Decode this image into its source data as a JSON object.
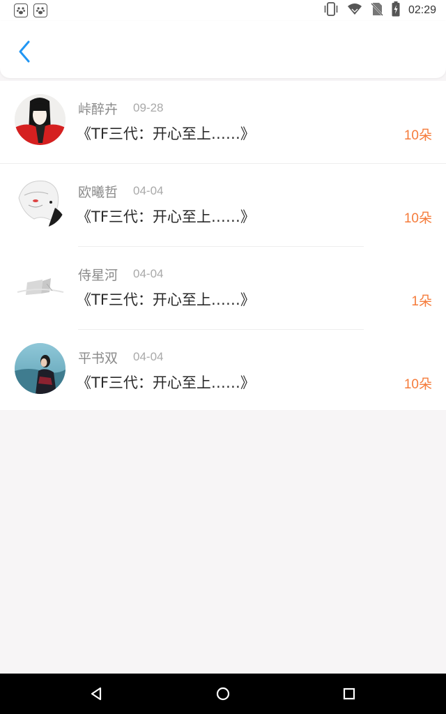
{
  "status_bar": {
    "time": "02:29",
    "left_icons": [
      "baidu-paw-icon",
      "baidu-paw-icon"
    ],
    "right_icons": [
      "vibrate-icon",
      "wifi-icon",
      "no-sim-icon",
      "battery-charging-icon"
    ]
  },
  "header": {
    "back_icon": "chevron-left-icon",
    "accent_color": "#2196f3"
  },
  "gifts": [
    {
      "name": "峠醉卉",
      "date": "09-28",
      "title": "《TF三代：开心至上……》",
      "amount": "10朵"
    },
    {
      "name": "欧曦哲",
      "date": "04-04",
      "title": "《TF三代：开心至上……》",
      "amount": "10朵"
    },
    {
      "name": "侍星河",
      "date": "04-04",
      "title": "《TF三代：开心至上……》",
      "amount": "1朵"
    },
    {
      "name": "平书双",
      "date": "04-04",
      "title": "《TF三代：开心至上……》",
      "amount": "10朵"
    }
  ],
  "colors": {
    "amount": "#f57b3a",
    "name": "#8a8a8a",
    "title": "#2a2a2a",
    "background": "#f7f5f6"
  },
  "nav_bar": {
    "icons": [
      "back-triangle-icon",
      "home-circle-icon",
      "recents-square-icon"
    ]
  }
}
